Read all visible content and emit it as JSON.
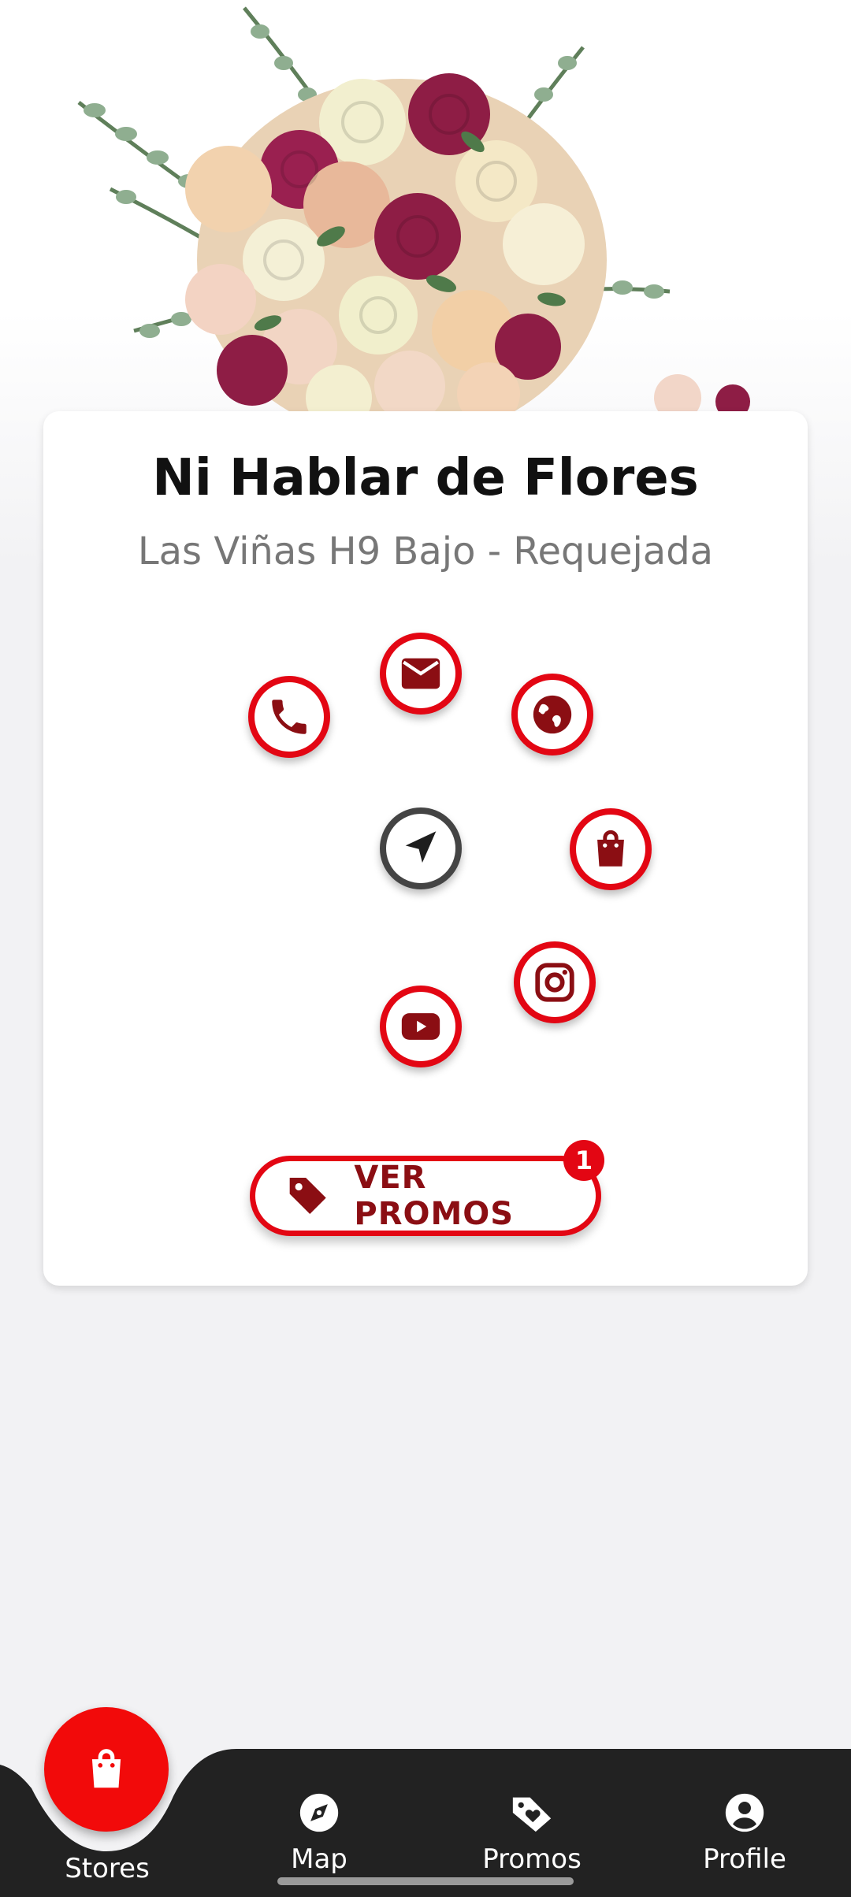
{
  "store": {
    "name": "Ni Hablar de Flores",
    "address": "Las Viñas H9 Bajo - Requejada"
  },
  "actions": [
    {
      "icon": "phone-icon"
    },
    {
      "icon": "mail-icon"
    },
    {
      "icon": "globe-icon"
    },
    {
      "icon": "navigation-arrow-icon"
    },
    {
      "icon": "shopping-bag-icon"
    },
    {
      "icon": "instagram-icon"
    },
    {
      "icon": "youtube-icon"
    }
  ],
  "promo_button": {
    "label": "VER PROMOS",
    "badge_count": "1",
    "icon": "tag-icon"
  },
  "bottom_nav": {
    "items": [
      {
        "label": "Stores",
        "icon": "shopping-bag-icon",
        "active": true
      },
      {
        "label": "Map",
        "icon": "compass-icon"
      },
      {
        "label": "Promos",
        "icon": "heart-tag-icon"
      },
      {
        "label": "Profile",
        "icon": "user-circle-icon"
      }
    ]
  },
  "colors": {
    "accent": "#e30613",
    "accent_dark": "#8b0e13",
    "nav_bg": "#222222",
    "background": "#f2f2f4"
  }
}
